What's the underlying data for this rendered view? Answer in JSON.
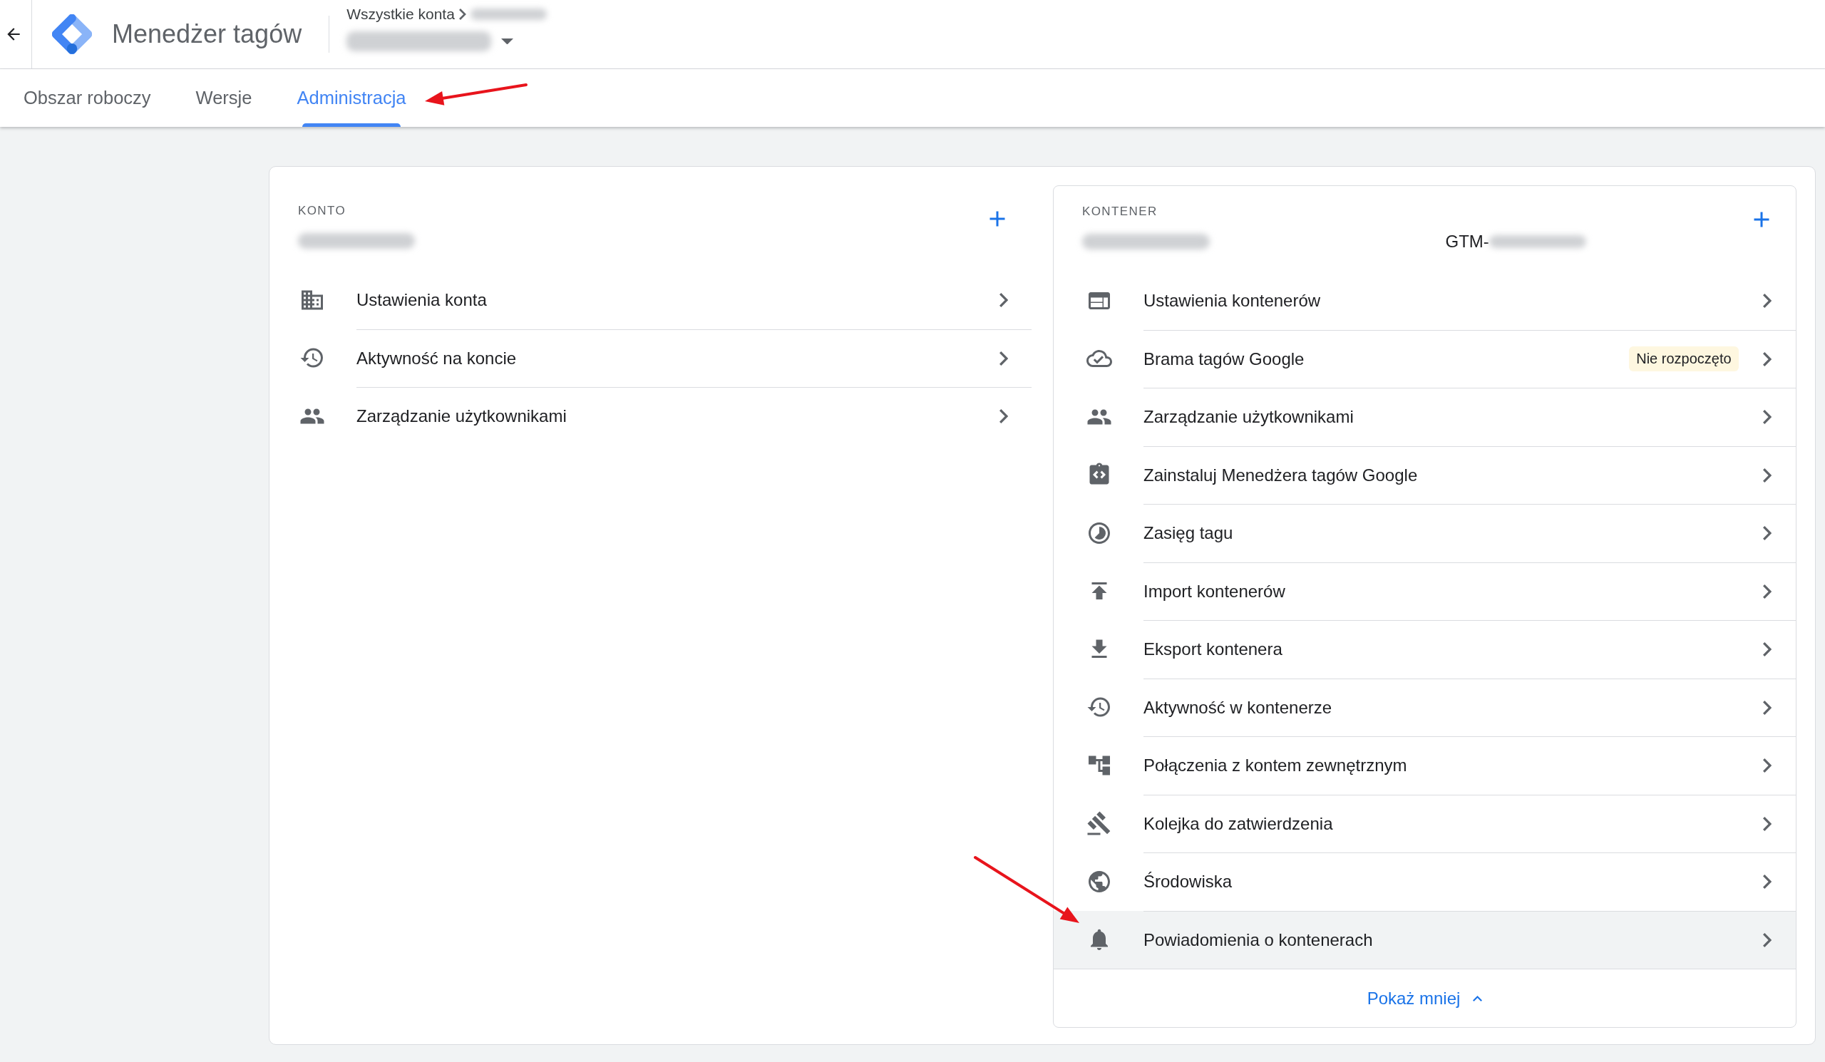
{
  "header": {
    "title": "Menedżer tagów",
    "breadcrumb": "Wszystkie konta"
  },
  "tabs": [
    {
      "label": "Obszar roboczy",
      "selected": false
    },
    {
      "label": "Wersje",
      "selected": false
    },
    {
      "label": "Administracja",
      "selected": true
    }
  ],
  "account": {
    "heading": "KONTO",
    "items": [
      {
        "label": "Ustawienia konta",
        "hovered": false
      },
      {
        "label": "Aktywność na koncie",
        "hovered": false
      },
      {
        "label": "Zarządzanie użytkownikami",
        "hovered": false
      }
    ]
  },
  "container": {
    "heading": "KONTENER",
    "id_prefix": "GTM-",
    "items": [
      {
        "label": "Ustawienia kontenerów",
        "hovered": false
      },
      {
        "label": "Brama tagów Google",
        "badge": "Nie rozpoczęto",
        "hovered": false
      },
      {
        "label": "Zarządzanie użytkownikami",
        "hovered": false
      },
      {
        "label": "Zainstaluj Menedżera tagów Google",
        "hovered": false
      },
      {
        "label": "Zasięg tagu",
        "hovered": false
      },
      {
        "label": "Import kontenerów",
        "hovered": false
      },
      {
        "label": "Eksport kontenera",
        "hovered": false
      },
      {
        "label": "Aktywność w kontenerze",
        "hovered": false
      },
      {
        "label": "Połączenia z kontem zewnętrznym",
        "hovered": false
      },
      {
        "label": "Kolejka do zatwierdzenia",
        "hovered": false
      },
      {
        "label": "Środowiska",
        "hovered": false
      },
      {
        "label": "Powiadomienia o kontenerach",
        "hovered": true
      }
    ],
    "show_less": "Pokaż mniej"
  }
}
